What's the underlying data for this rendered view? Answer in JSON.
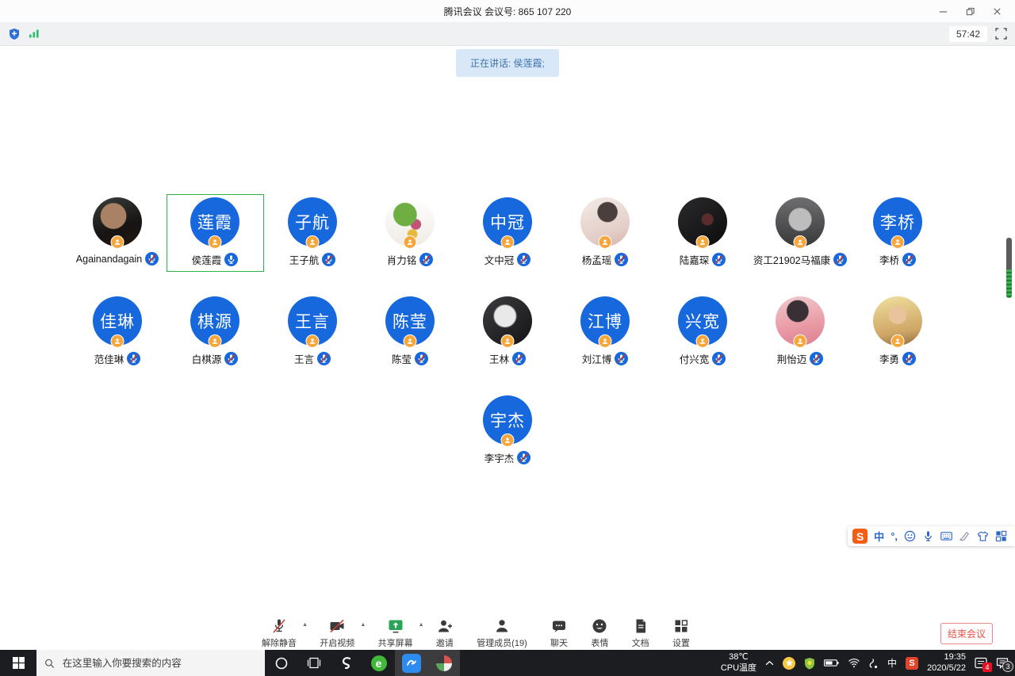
{
  "window": {
    "title": "腾讯会议 会议号: 865 107 220"
  },
  "topbar": {
    "timer": "57:42",
    "left_icon_names": [
      "security-shield-icon",
      "network-signal-icon"
    ],
    "right_icon_names": [
      "fullscreen-icon"
    ]
  },
  "banner": {
    "text": "正在讲话: 侯莲霞;"
  },
  "colors": {
    "avatar_blue": "#1668dc",
    "selection_green": "#2cb14c",
    "banner_bg": "#d8e8f8",
    "banner_text": "#3c72ab",
    "end_button_red": "#e4544b",
    "share_green": "#2aa558",
    "host_badge_orange": "#f6a63a",
    "mute_slash_red": "#c63a30"
  },
  "participants": {
    "rows": [
      [
        {
          "name": "Againandagain",
          "photo_bg": "radial-gradient(circle at 42% 38%, #a98266 0 30%, rgba(0,0,0,0) 32%), linear-gradient(160deg, #3a3f3d, #171413 60%, #23170f)",
          "host": true,
          "mic": "muted"
        },
        {
          "name": "侯莲霞",
          "avatar_text": "莲霞",
          "mic": "on",
          "selected": true
        },
        {
          "name": "王子航",
          "avatar_text": "子航",
          "mic": "muted"
        },
        {
          "name": "肖力铭",
          "photo_bg": "radial-gradient(circle at 40% 35%, #6fae43 0 26%, rgba(0,0,0,0) 28%), radial-gradient(circle at 62% 55%, #c2527a 0 12%, rgba(0,0,0,0) 14%), radial-gradient(circle at 55% 75%, #e8b93a 0 10%, rgba(0,0,0,0) 12%), linear-gradient(180deg,#ffffff,#efece4)",
          "mic": "muted"
        },
        {
          "name": "文中冠",
          "avatar_text": "中冠",
          "mic": "muted"
        },
        {
          "name": "杨孟瑶",
          "photo_bg": "radial-gradient(circle at 55% 30%, #4a3f3c 0 22%, rgba(0,0,0,0) 24%), linear-gradient(160deg,#f3ece8,#e3cdc6 70%,#d6b0ad)",
          "mic": "muted"
        },
        {
          "name": "陆嘉琛",
          "photo_bg": "radial-gradient(circle at 60% 45%, #5c2b2b 0 14%, rgba(0,0,0,0) 16%), linear-gradient(140deg,#2b2b2d,#0c0c0d)",
          "mic": "muted"
        },
        {
          "name": "资工21902马福康",
          "photo_bg": "radial-gradient(circle at 50% 45%, #bdbdbd 0 30%, rgba(0,0,0,0) 33%), linear-gradient(180deg,#6e6e70,#39393b)",
          "mic": "muted"
        },
        {
          "name": "李桥",
          "avatar_text": "李桥",
          "mic": "muted"
        }
      ],
      [
        {
          "name": "范佳琳",
          "avatar_text": "佳琳",
          "mic": "muted"
        },
        {
          "name": "白棋源",
          "avatar_text": "棋源",
          "mic": "muted"
        },
        {
          "name": "王言",
          "avatar_text": "王言",
          "mic": "muted"
        },
        {
          "name": "陈莹",
          "avatar_text": "陈莹",
          "mic": "muted"
        },
        {
          "name": "王林",
          "photo_bg": "radial-gradient(circle at 45% 40%, #e9e9ea 0 26%, rgba(0,0,0,0) 30%), linear-gradient(140deg,#3c3c40,#141416)",
          "mic": "muted"
        },
        {
          "name": "刘江博",
          "avatar_text": "江博",
          "mic": "muted"
        },
        {
          "name": "付兴宽",
          "avatar_text": "兴宽",
          "mic": "muted"
        },
        {
          "name": "荆怡迈",
          "photo_bg": "radial-gradient(circle at 45% 30%, #383034 0 24%, rgba(0,0,0,0) 26%), linear-gradient(170deg,#efc9cd,#e99aa4 60%,#dd7f90)",
          "mic": "muted"
        },
        {
          "name": "李勇",
          "photo_bg": "radial-gradient(circle at 50% 38%, #e9c39b 0 22%, rgba(0,0,0,0) 24%), linear-gradient(170deg,#efdf9e,#cfa666 70%,#8e6b3f)",
          "mic": "muted"
        }
      ],
      [
        {
          "name": "李宇杰",
          "avatar_text": "宇杰",
          "mic": "muted"
        }
      ]
    ]
  },
  "toolbar": {
    "buttons": [
      {
        "label": "解除静音",
        "icon": "mic-off-icon",
        "caret": true
      },
      {
        "label": "开启视频",
        "icon": "camera-off-icon",
        "caret": true
      },
      {
        "label": "共享屏幕",
        "icon": "share-screen-icon",
        "caret": true
      },
      {
        "label": "邀请",
        "icon": "invite-icon"
      },
      {
        "label": "管理成员(19)",
        "icon": "members-icon"
      },
      {
        "label": "聊天",
        "icon": "chat-icon"
      },
      {
        "label": "表情",
        "icon": "emoji-icon"
      },
      {
        "label": "文档",
        "icon": "doc-icon"
      },
      {
        "label": "设置",
        "icon": "settings-icon"
      }
    ],
    "end_label": "结束会议"
  },
  "ime": {
    "logo_letter": "S",
    "lang_label": "中",
    "punct_label": "°,",
    "icon_names": [
      "sogou-logo",
      "chinese-mode",
      "punctuation-icon",
      "emoji-icon",
      "mic-icon",
      "keyboard-icon",
      "handwriting-icon",
      "skin-icon",
      "toolbox-icon"
    ]
  },
  "taskbar": {
    "search_placeholder": "在这里输入你要搜索的内容",
    "app_icon_names": [
      "start-icon",
      "search-icon",
      "cortana-icon",
      "task-view-icon",
      "swirl-app-icon",
      "green-e-browser-icon",
      "tencent-meeting-icon",
      "color-wheel-app-icon"
    ],
    "tray": {
      "temp_value": "38℃",
      "temp_label": "CPU温度",
      "ime_lang": "中",
      "sogou_letter": "S",
      "time": "19:35",
      "date": "2020/5/22",
      "badge_notifications": "4",
      "badge_messages": "3",
      "tray_icon_names": [
        "chevron-up-icon",
        "yellow-app-icon",
        "shield-icon",
        "battery-icon",
        "wifi-icon",
        "audio-cable-icon",
        "ime-language-indicator",
        "sogou-tray-icon",
        "notification-panel-icon",
        "message-center-icon"
      ]
    }
  }
}
